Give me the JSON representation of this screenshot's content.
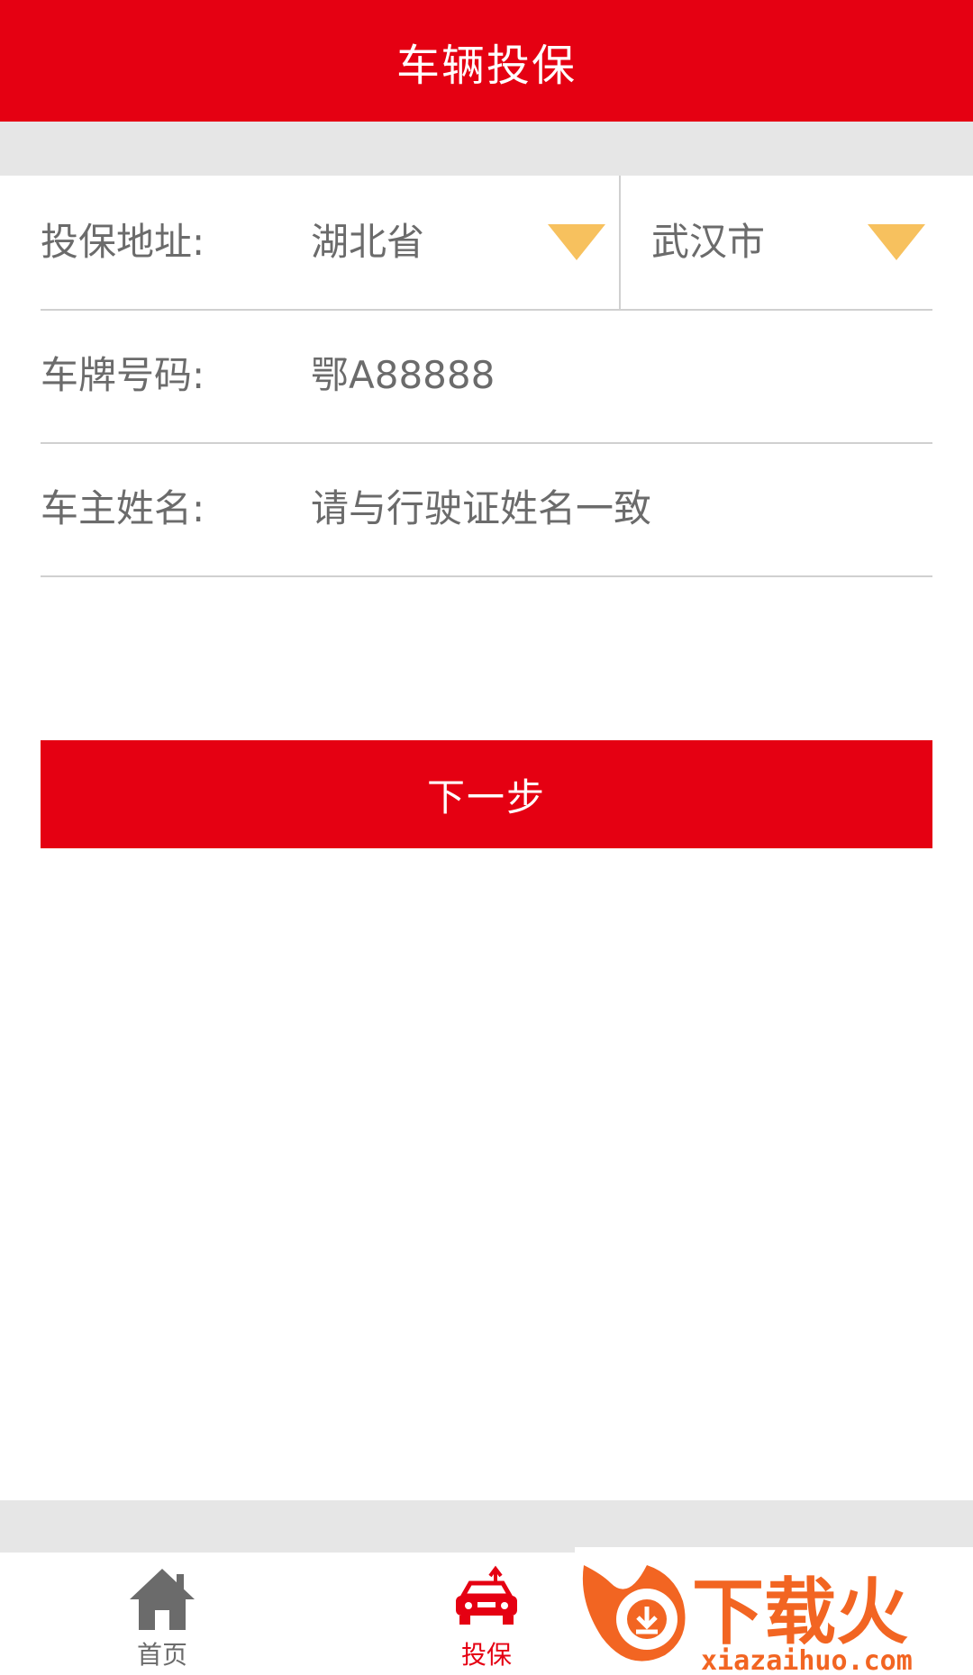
{
  "header": {
    "title": "车辆投保"
  },
  "form": {
    "address": {
      "label": "投保地址:",
      "province": "湖北省",
      "city": "武汉市"
    },
    "plate": {
      "label": "车牌号码:",
      "value": "鄂A88888"
    },
    "owner": {
      "label": "车主姓名:",
      "placeholder": "请与行驶证姓名一致"
    }
  },
  "next_button": {
    "label": "下一步"
  },
  "tabbar": {
    "home": {
      "label": "首页",
      "icon": "home-icon"
    },
    "insure": {
      "label": "投保",
      "icon": "car-insure-icon"
    }
  },
  "watermark": {
    "text": "下载火",
    "url": "xiazaihuo.com"
  },
  "colors": {
    "brand_red": "#e50012",
    "arrow": "#f7c15e",
    "text_gray": "#6b6b6b"
  }
}
